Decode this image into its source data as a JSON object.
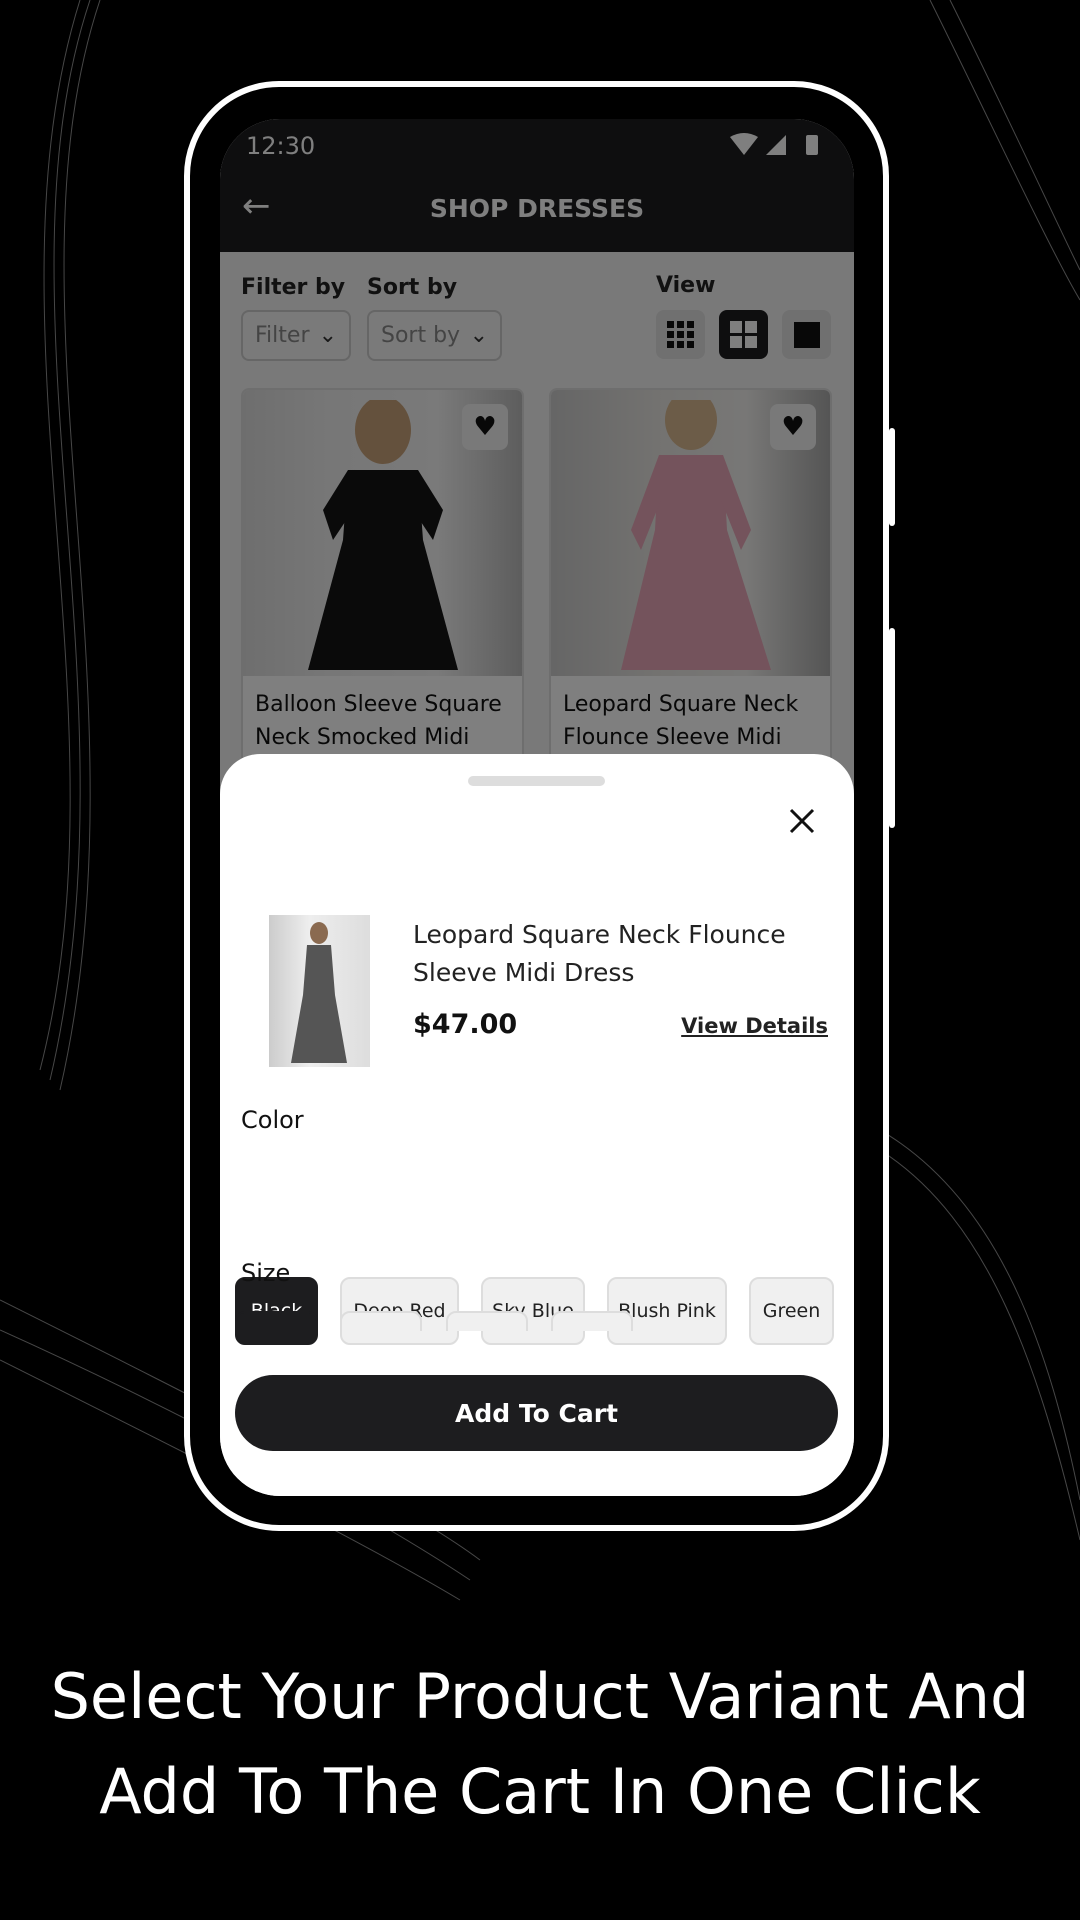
{
  "status": {
    "time": "12:30",
    "icons": [
      "wifi-icon",
      "signal-icon",
      "battery-icon"
    ]
  },
  "appbar": {
    "title": "SHOP DRESSES",
    "back_icon": "arrow-left-icon"
  },
  "toolbar": {
    "filter_label": "Filter by",
    "filter_value": "Filter",
    "sort_label": "Sort by",
    "sort_value": "Sort by",
    "view_label": "View",
    "view_options": [
      "grid-3-icon",
      "grid-2-icon",
      "single-icon"
    ],
    "view_selected": "grid-2-icon"
  },
  "products": [
    {
      "title_line1": "Balloon Sleeve Square",
      "title_line2": "Neck Smocked Midi"
    },
    {
      "title_line1": "Leopard Square Neck",
      "title_line2": "Flounce Sleeve Midi"
    }
  ],
  "sheet": {
    "product_line1": "Leopard Square Neck Flounce",
    "product_line2": "Sleeve Midi Dress",
    "price": "$47.00",
    "view_details": "View Details",
    "color_label": "Color",
    "colors": [
      "Black",
      "Deep Red",
      "Sky Blue",
      "Blush Pink",
      "Green"
    ],
    "selected_color": "Black",
    "size_label": "Size",
    "add_to_cart": "Add To Cart"
  },
  "caption": {
    "line1": "Select Your Product Variant And",
    "line2": "Add To The Cart In One Click"
  },
  "colors": {
    "dark": "#1d1d1f",
    "background": "#000000"
  }
}
